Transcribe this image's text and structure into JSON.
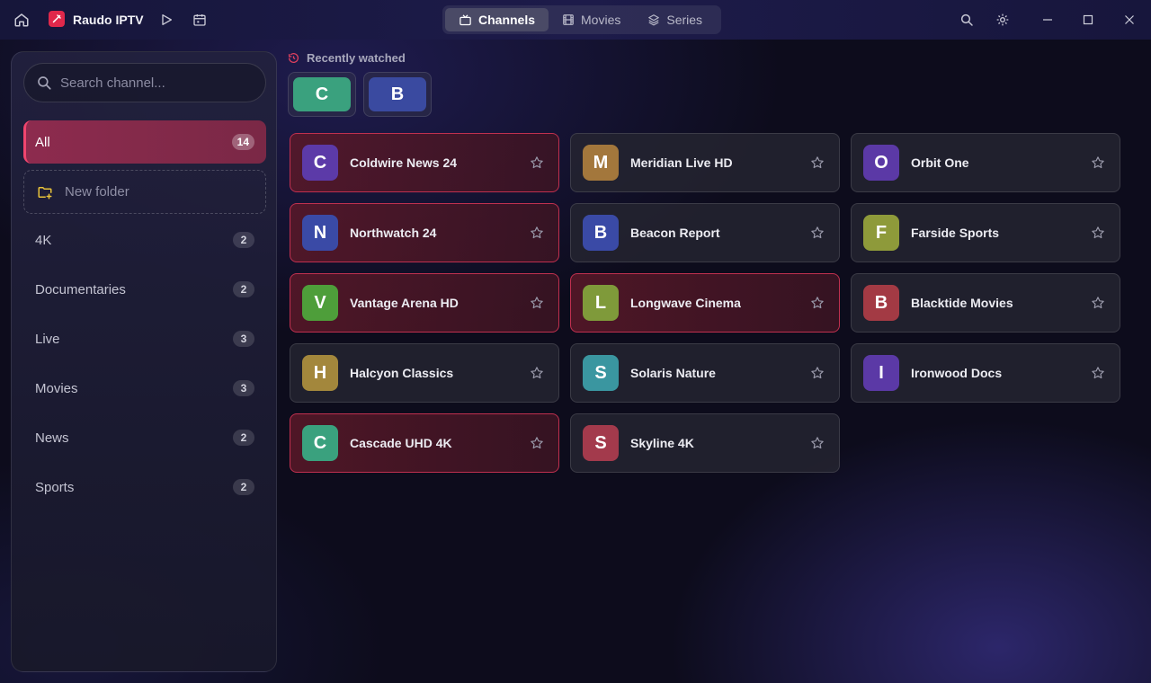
{
  "app": {
    "name": "Raudo IPTV"
  },
  "tabs": [
    {
      "label": "Channels",
      "icon": "tv-icon",
      "active": true
    },
    {
      "label": "Movies",
      "icon": "film-icon",
      "active": false
    },
    {
      "label": "Series",
      "icon": "layers-icon",
      "active": false
    }
  ],
  "search": {
    "placeholder": "Search channel..."
  },
  "sidebar": {
    "new_folder_label": "New folder",
    "folders": [
      {
        "label": "All",
        "count": "14",
        "active": true
      },
      {
        "label": "4K",
        "count": "2"
      },
      {
        "label": "Documentaries",
        "count": "2"
      },
      {
        "label": "Live",
        "count": "3"
      },
      {
        "label": "Movies",
        "count": "3"
      },
      {
        "label": "News",
        "count": "2"
      },
      {
        "label": "Sports",
        "count": "2"
      }
    ]
  },
  "recent": {
    "label": "Recently watched",
    "items": [
      {
        "letter": "C",
        "color": "#3aa17e"
      },
      {
        "letter": "B",
        "color": "#3a4aa0"
      }
    ]
  },
  "channels": [
    {
      "letter": "C",
      "name": "Coldwire News 24",
      "color": "#5c3aa8",
      "favorite": true
    },
    {
      "letter": "M",
      "name": "Meridian Live HD",
      "color": "#a3773c",
      "favorite": false
    },
    {
      "letter": "O",
      "name": "Orbit One",
      "color": "#5b39a6",
      "favorite": false
    },
    {
      "letter": "N",
      "name": "Northwatch 24",
      "color": "#3a4aa6",
      "favorite": true
    },
    {
      "letter": "B",
      "name": "Beacon Report",
      "color": "#3a4aa6",
      "favorite": false
    },
    {
      "letter": "F",
      "name": "Farside Sports",
      "color": "#8e9a3a",
      "favorite": false
    },
    {
      "letter": "V",
      "name": "Vantage Arena HD",
      "color": "#4e9e3a",
      "favorite": true
    },
    {
      "letter": "L",
      "name": "Longwave Cinema",
      "color": "#7f9a3a",
      "favorite": true
    },
    {
      "letter": "B",
      "name": "Blacktide Movies",
      "color": "#a33a44",
      "favorite": false
    },
    {
      "letter": "H",
      "name": "Halcyon Classics",
      "color": "#a3873c",
      "favorite": false
    },
    {
      "letter": "S",
      "name": "Solaris Nature",
      "color": "#3a96a0",
      "favorite": false
    },
    {
      "letter": "I",
      "name": "Ironwood Docs",
      "color": "#5b39a6",
      "favorite": false
    },
    {
      "letter": "C",
      "name": "Cascade UHD 4K",
      "color": "#3aa17e",
      "favorite": true
    },
    {
      "letter": "S",
      "name": "Skyline 4K",
      "color": "#a33a4c",
      "favorite": false
    }
  ],
  "colors": {
    "accent": "#e0284b",
    "fav_border": "#c0304f",
    "active_folder": "#8d2b4e"
  }
}
